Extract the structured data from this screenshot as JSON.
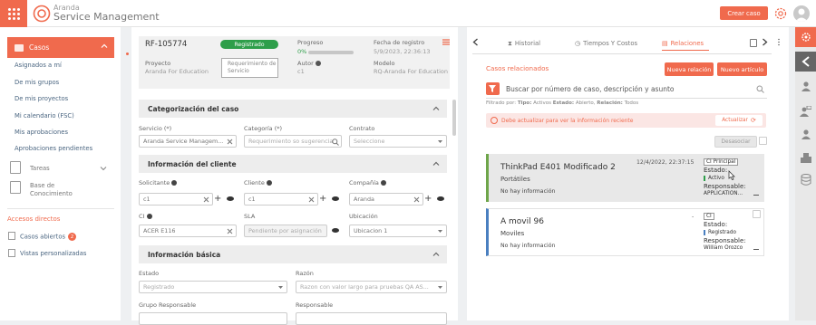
{
  "header": {
    "brand_line1": "Aranda",
    "brand_line2": "Service Management",
    "create_case": "Crear caso"
  },
  "colors": {
    "accent": "#f06a4d",
    "status_green": "#2e9e4a",
    "link_blue": "#4a6580"
  },
  "sidebar": {
    "active": "Casos",
    "items": [
      "Asignados a mí",
      "De mis grupos",
      "De mis proyectos",
      "Mi calendario (FSC)",
      "Mis aprobaciones",
      "Aprobaciones pendientes"
    ],
    "tareas": "Tareas",
    "base_line1": "Base de",
    "base_line2": "Conocimiento",
    "accesos_title": "Accesos directos",
    "casos_abiertos": "Casos abiertos",
    "casos_abiertos_count": "2",
    "vistas": "Vistas personalizadas"
  },
  "case": {
    "id": "RF-105774",
    "status": "Registrado",
    "progress_label": "Progreso",
    "progress_value": "0%",
    "progress_fraction": 0,
    "date_label": "Fecha de registro",
    "date_value": "5/9/2023, 22:36:13",
    "project_label": "Proyecto",
    "project_value": "Aranda For Education",
    "req_type_line1": "Requerimiento de",
    "req_type_line2": "Servicio",
    "autor_label": "Autor",
    "autor_value": "c1",
    "model_label": "Modelo",
    "model_value": "RQ-Aranda For Education"
  },
  "sections": {
    "categorization": {
      "title": "Categorización del caso",
      "service_label": "Servicio (*)",
      "service_value": "Aranda Service Managem...",
      "category_label": "Categoría (*)",
      "category_placeholder": "Requerimiento so sugerencia",
      "contract_label": "Contrato",
      "contract_placeholder": "Seleccione"
    },
    "client": {
      "title": "Información del cliente",
      "requester_label": "Solicitante",
      "requester_value": "c1",
      "client_label": "Cliente",
      "client_value": "c1",
      "company_label": "Compañía",
      "company_value": "Aranda",
      "ci_label": "CI",
      "ci_value": "ACER E116",
      "sla_label": "SLA",
      "sla_value": "Pendiente por asignación",
      "location_label": "Ubicación",
      "location_value": "Ubicacion 1"
    },
    "basic": {
      "title": "Información básica",
      "state_label": "Estado",
      "state_value": "Registrado",
      "reason_label": "Razón",
      "reason_value": "Razon con valor largo para pruebas QA AS...",
      "group_label": "Grupo Responsable",
      "responsible_label": "Responsable"
    }
  },
  "panel": {
    "tabs": [
      "Historial",
      "Tiempos Y Costos",
      "Relaciones"
    ],
    "related_title": "Casos relacionados",
    "new_relation": "Nueva relación",
    "new_article": "Nuevo artículo",
    "search_placeholder": "Buscar por número de caso, descripción y asunto",
    "filter_prefix": "Filtrado por:",
    "filter_tipo_label": "Tipo:",
    "filter_tipo_value": "Activos",
    "filter_estado_label": "Estado:",
    "filter_estado_value": "Abierto,",
    "filter_relacion_label": "Relación:",
    "filter_relacion_value": "Todos",
    "alert": "Debe actualizar para ver la información reciente",
    "refresh": "Actualizar",
    "desasociar": "Desasociar",
    "cards": [
      {
        "title": "ThinkPad E401 Modificado 2",
        "subtitle": "Portátiles",
        "info": "No hay información",
        "date": "12/4/2022, 22:37:15",
        "tag": "CI Principal",
        "estado_label": "Estado:",
        "estado_value": "Activo",
        "resp_label": "Responsable:",
        "resp_value": "APPLICATION..."
      },
      {
        "title": "A movil 96",
        "subtitle": "Moviles",
        "info": "No hay información",
        "date": "-",
        "tag": "CI",
        "estado_label": "Estado:",
        "estado_value": "Registrado",
        "resp_label": "Responsable:",
        "resp_value": "William Orozco"
      }
    ]
  }
}
